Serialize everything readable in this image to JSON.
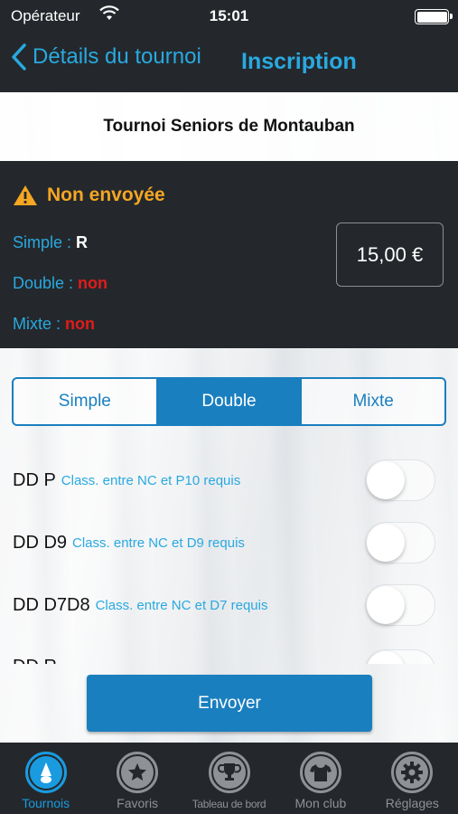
{
  "status_bar": {
    "carrier": "Opérateur",
    "time": "15:01"
  },
  "nav": {
    "back_label": "Détails du tournoi",
    "title": "Inscription"
  },
  "tournament_name": "Tournoi Seniors de Montauban",
  "status": {
    "label": "Non envoyée",
    "simple_label": "Simple : ",
    "simple_value": "R",
    "double_label": "Double : ",
    "double_value": "non",
    "mixte_label": "Mixte : ",
    "mixte_value": "non",
    "price": "15,00 €"
  },
  "segments": [
    "Simple",
    "Double",
    "Mixte"
  ],
  "active_segment": "Double",
  "events": [
    {
      "name": "DD P",
      "requirement": "Class. entre NC et P10 requis",
      "enabled": false
    },
    {
      "name": "DD D9",
      "requirement": "Class. entre NC et D9 requis",
      "enabled": false
    },
    {
      "name": "DD D7D8",
      "requirement": "Class. entre NC et D7 requis",
      "enabled": false
    },
    {
      "name": "DD R",
      "requirement": "",
      "enabled": false
    }
  ],
  "send_button": "Envoyer",
  "tabs": [
    {
      "label": "Tournois",
      "icon": "shuttlecock-icon",
      "active": true
    },
    {
      "label": "Favoris",
      "icon": "star-icon",
      "active": false
    },
    {
      "label": "Tableau de bord",
      "icon": "trophy-icon",
      "active": false
    },
    {
      "label": "Mon club",
      "icon": "shirt-icon",
      "active": false
    },
    {
      "label": "Réglages",
      "icon": "gear-icon",
      "active": false
    }
  ],
  "colors": {
    "accent": "#1a7fbf",
    "link_blue": "#29a9e0",
    "warning": "#f5a623",
    "negative": "#e21b1b",
    "dark_bar": "#24282c"
  }
}
